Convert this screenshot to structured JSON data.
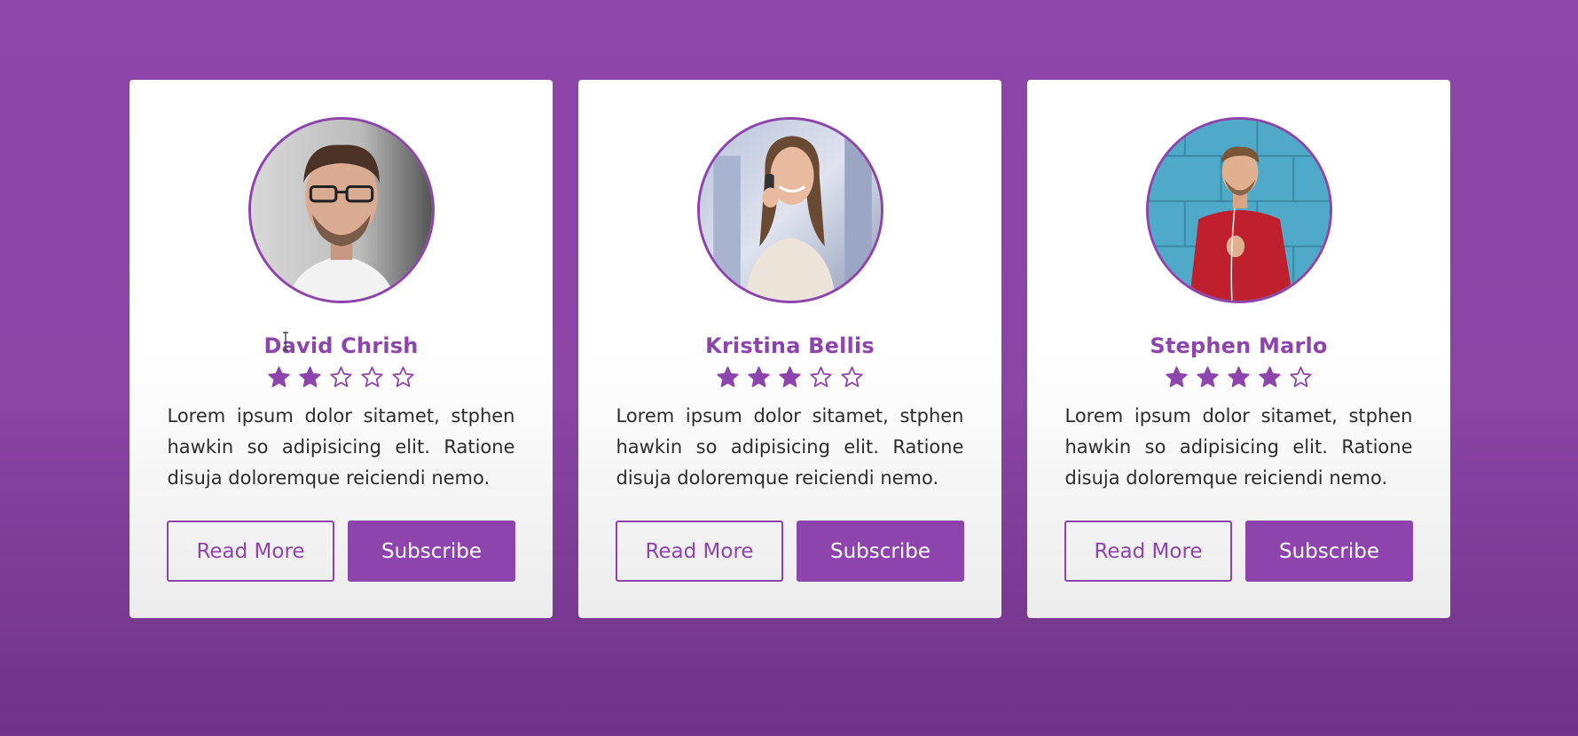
{
  "colors": {
    "accent": "#8e44ad",
    "background": "#8e46a8",
    "card": "#ffffff",
    "text": "#2c2c2c"
  },
  "cards": [
    {
      "name": "David Chrish",
      "rating": 2,
      "rating_max": 5,
      "description": "Lorem ipsum dolor sitamet, stphen hawkin so adipisicing elit. Ratione disuja doloremque reiciendi nemo.",
      "read_more": "Read More",
      "subscribe": "Subscribe",
      "photo": "man-with-glasses-photo"
    },
    {
      "name": "Kristina Bellis",
      "rating": 3,
      "rating_max": 5,
      "description": "Lorem ipsum dolor sitamet, stphen hawkin so adipisicing elit. Ratione disuja doloremque reiciendi nemo.",
      "read_more": "Read More",
      "subscribe": "Subscribe",
      "photo": "woman-on-phone-photo"
    },
    {
      "name": "Stephen Marlo",
      "rating": 4,
      "rating_max": 5,
      "description": "Lorem ipsum dolor sitamet, stphen hawkin so adipisicing elit. Ratione disuja doloremque reiciendi nemo.",
      "read_more": "Read More",
      "subscribe": "Subscribe",
      "photo": "man-in-red-sweater-photo"
    }
  ]
}
